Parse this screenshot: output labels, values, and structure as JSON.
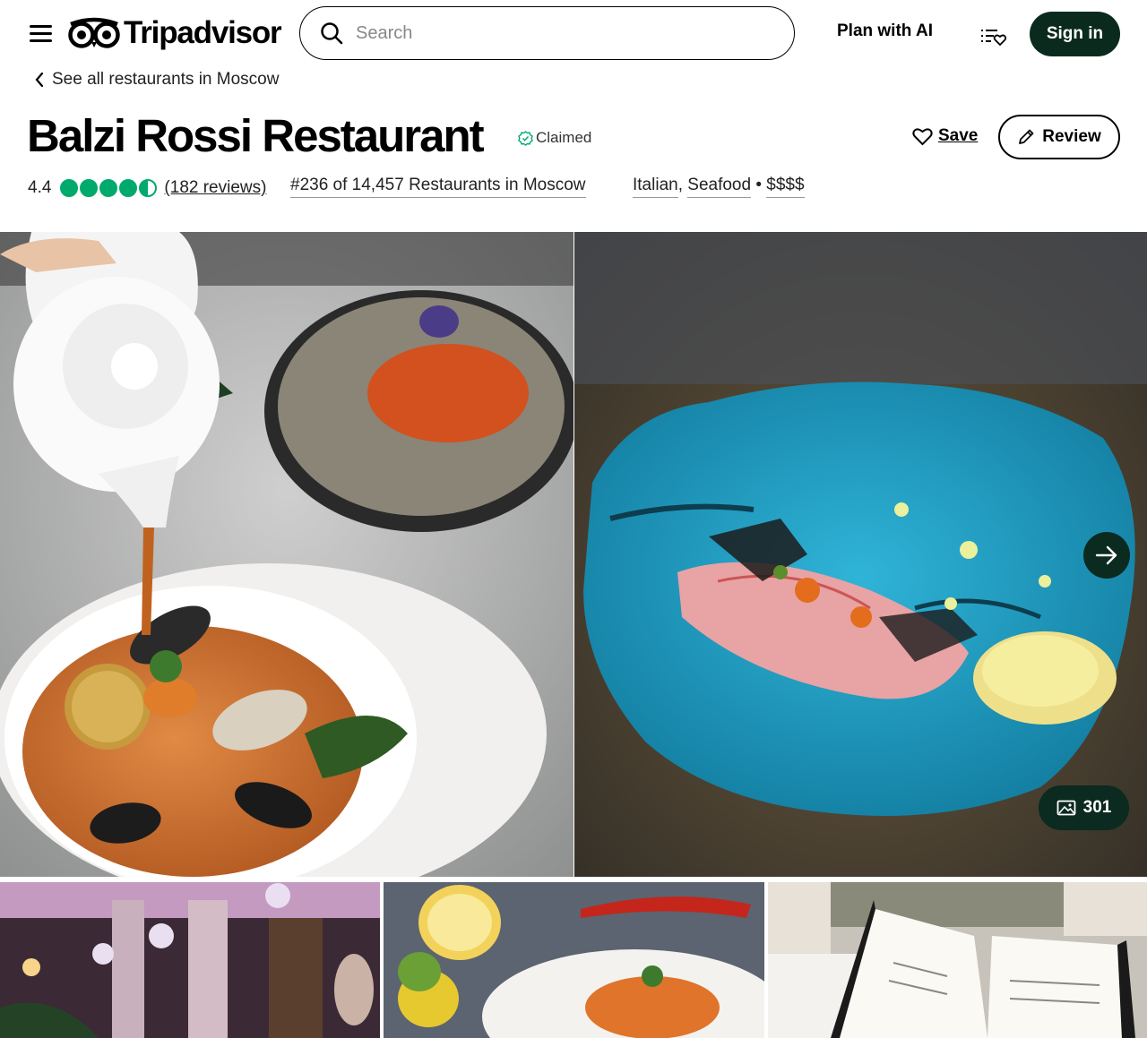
{
  "header": {
    "logo_text": "Tripadvisor",
    "search_placeholder": "Search",
    "plan_ai_label": "Plan with AI",
    "signin_label": "Sign in"
  },
  "breadcrumb": {
    "label": "See all restaurants in Moscow"
  },
  "restaurant": {
    "name": "Balzi Rossi Restaurant",
    "claimed_label": "Claimed",
    "rating": 4.4,
    "rating_text": "4.4",
    "reviews_text": "(182 reviews)",
    "rank_text": "#236 of 14,457 Restaurants in Moscow",
    "cuisines": [
      "Italian",
      "Seafood"
    ],
    "price": "$$$$"
  },
  "actions": {
    "save_label": "Save",
    "review_label": "Review"
  },
  "gallery": {
    "photo_count": "301"
  },
  "colors": {
    "brand_green": "#00aa6c",
    "dark_green": "#0b2a20"
  }
}
